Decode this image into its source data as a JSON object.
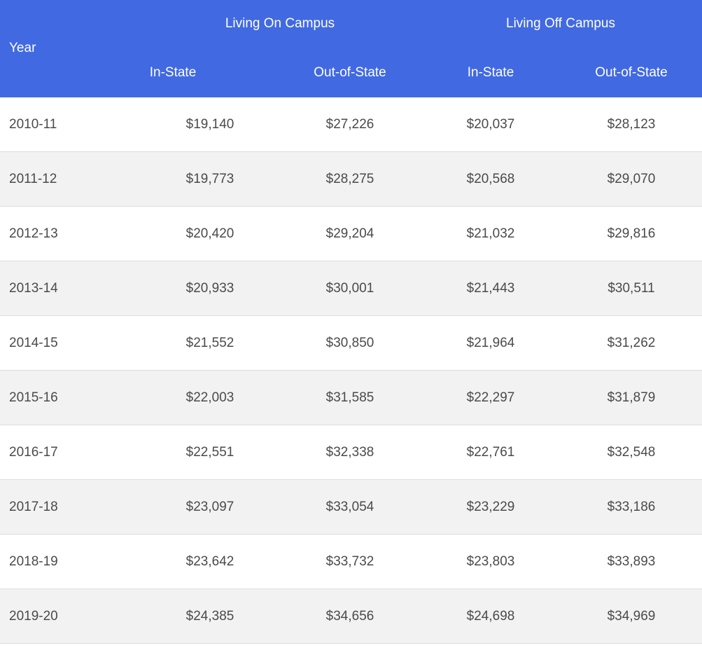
{
  "table": {
    "headers": {
      "year": "Year",
      "group_on": "Living On Campus",
      "group_off": "Living Off Campus",
      "on_in_state": "In-State",
      "on_out_state": "Out-of-State",
      "off_in_state": "In-State",
      "off_out_state": "Out-of-State"
    },
    "rows": [
      {
        "year": "2010-11",
        "on_in": "$19,140",
        "on_out": "$27,226",
        "off_in": "$20,037",
        "off_out": "$28,123"
      },
      {
        "year": "2011-12",
        "on_in": "$19,773",
        "on_out": "$28,275",
        "off_in": "$20,568",
        "off_out": "$29,070"
      },
      {
        "year": "2012-13",
        "on_in": "$20,420",
        "on_out": "$29,204",
        "off_in": "$21,032",
        "off_out": "$29,816"
      },
      {
        "year": "2013-14",
        "on_in": "$20,933",
        "on_out": "$30,001",
        "off_in": "$21,443",
        "off_out": "$30,511"
      },
      {
        "year": "2014-15",
        "on_in": "$21,552",
        "on_out": "$30,850",
        "off_in": "$21,964",
        "off_out": "$31,262"
      },
      {
        "year": "2015-16",
        "on_in": "$22,003",
        "on_out": "$31,585",
        "off_in": "$22,297",
        "off_out": "$31,879"
      },
      {
        "year": "2016-17",
        "on_in": "$22,551",
        "on_out": "$32,338",
        "off_in": "$22,761",
        "off_out": "$32,548"
      },
      {
        "year": "2017-18",
        "on_in": "$23,097",
        "on_out": "$33,054",
        "off_in": "$23,229",
        "off_out": "$33,186"
      },
      {
        "year": "2018-19",
        "on_in": "$23,642",
        "on_out": "$33,732",
        "off_in": "$23,803",
        "off_out": "$33,893"
      },
      {
        "year": "2019-20",
        "on_in": "$24,385",
        "on_out": "$34,656",
        "off_in": "$24,698",
        "off_out": "$34,969"
      }
    ]
  },
  "colors": {
    "header_bg": "#4169e1",
    "header_text": "#ffffff",
    "row_alt_bg": "#f2f2f2",
    "row_text": "#4a4a4a"
  }
}
